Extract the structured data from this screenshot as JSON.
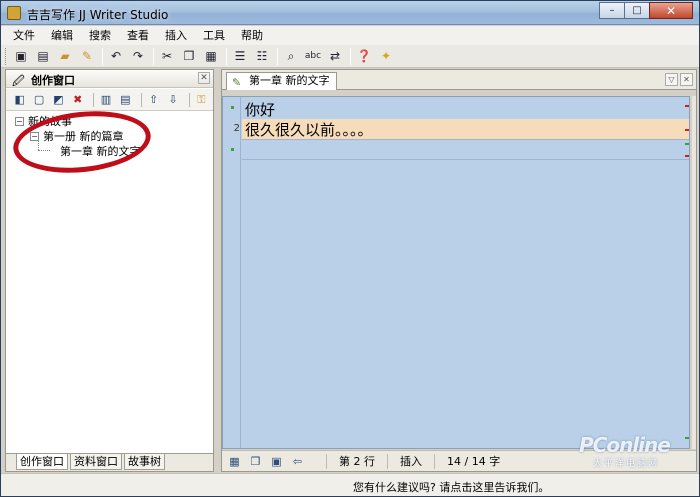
{
  "window": {
    "title": "吉吉写作 JJ Writer Studio",
    "buttons": {
      "minimize": "–",
      "maximize": "□",
      "close": "✕"
    }
  },
  "menu": [
    "文件",
    "编辑",
    "搜索",
    "查看",
    "插入",
    "工具",
    "帮助"
  ],
  "toolbar_icons": [
    "save-icon",
    "save-all-icon",
    "open-folder-icon",
    "new-doc-icon",
    "undo-icon",
    "redo-icon",
    "cut-icon",
    "copy-icon",
    "paste-icon",
    "indent-left-icon",
    "indent-right-icon",
    "find-icon",
    "spellcheck-icon",
    "replace-icon",
    "help-icon",
    "tip-bulb-icon"
  ],
  "left_panel": {
    "title": "创作窗口",
    "close": "✕",
    "tree": {
      "root": "新的故事",
      "volume": "第一册 新的篇章",
      "chapter": "第一章 新的文字"
    },
    "tabs": [
      "创作窗口",
      "资料窗口",
      "故事树"
    ]
  },
  "document": {
    "tab_label": "第一章 新的文字",
    "lines": [
      {
        "number": "",
        "text": "你好"
      },
      {
        "number": "2",
        "text": "很久很久以前。。。。"
      }
    ]
  },
  "status_bar": {
    "line": "第 2 行",
    "mode": "插入",
    "char_count": "14 / 14 字"
  },
  "footer": {
    "suggestion": "您有什么建议吗? 请点击这里告诉我们。"
  },
  "watermark": {
    "brand": "PConline",
    "sub": "太平洋电脑网"
  },
  "colors": {
    "editor_bg": "#b9d0e8",
    "current_line": "#f7dcbc",
    "annotation": "#c00d1a"
  }
}
